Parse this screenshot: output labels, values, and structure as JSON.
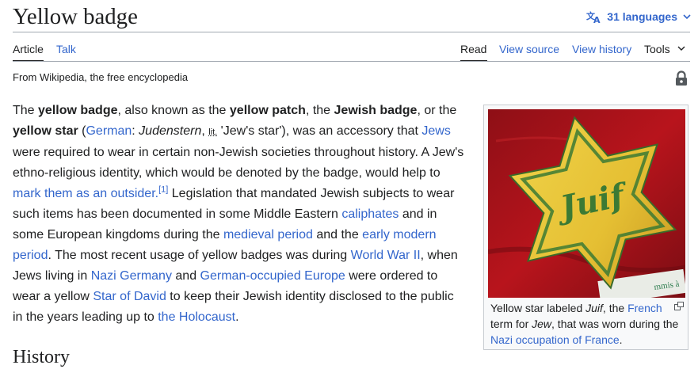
{
  "title": "Yellow badge",
  "languages": {
    "label": "31 languages"
  },
  "tabs": {
    "article": "Article",
    "talk": "Talk",
    "read": "Read",
    "view_source": "View source",
    "view_history": "View history",
    "tools": "Tools"
  },
  "tagline": "From Wikipedia, the free encyclopedia",
  "lead": {
    "t1": "The ",
    "b1": "yellow badge",
    "t2": ", also known as the ",
    "b2": "yellow patch",
    "t3": ", the ",
    "b3": "Jewish badge",
    "t4": ", or the ",
    "b4": "yellow star",
    "t5": " (",
    "l_german": "German",
    "t6": ": ",
    "i_judenstern": "Judenstern",
    "t7": ", ",
    "lit": "lit.",
    "t8": " 'Jew's star'), was an accessory that ",
    "l_jews": "Jews",
    "t9": " were required to wear in certain non-Jewish societies throughout history. A Jew's ethno-religious identity, which would be denoted by the badge, would help to ",
    "l_outsider": "mark them as an outsider.",
    "ref1": "[1]",
    "t10": " Legislation that mandated Jewish subjects to wear such items has been documented in some Middle Eastern ",
    "l_caliphates": "caliphates",
    "t11": " and in some European kingdoms during the ",
    "l_medieval": "medieval period",
    "t12": " and the ",
    "l_early_modern": "early modern period",
    "t13": ". The most recent usage of yellow badges was during ",
    "l_ww2": "World War II",
    "t14": ", when Jews living in ",
    "l_nazi_germany": "Nazi Germany",
    "t15": " and ",
    "l_german_occupied": "German-occupied Europe",
    "t16": " were ordered to wear a yellow ",
    "l_star_of_david": "Star of David",
    "t17": " to keep their Jewish identity disclosed to the public in the years leading up to ",
    "l_holocaust": "the Holocaust",
    "t18": "."
  },
  "infobox": {
    "star_text": "Juif",
    "cap_t1": "Yellow star labeled ",
    "cap_i1": "Juif",
    "cap_t2": ", the ",
    "cap_l_french": "French",
    "cap_t3": " term for ",
    "cap_i2": "Jew",
    "cap_t4": ", that was worn during the ",
    "cap_l_occupation": "Nazi occupation of France",
    "cap_t5": "."
  },
  "section": {
    "history": "History"
  },
  "colors": {
    "link": "#3366cc",
    "text": "#202122",
    "border": "#a2a9b1",
    "badge_yellow": "#e8c43a",
    "cloth_red": "#b8141c"
  },
  "icons": {
    "languages": "translate-icon",
    "lock": "lock-icon",
    "enlarge": "enlarge-icon"
  }
}
